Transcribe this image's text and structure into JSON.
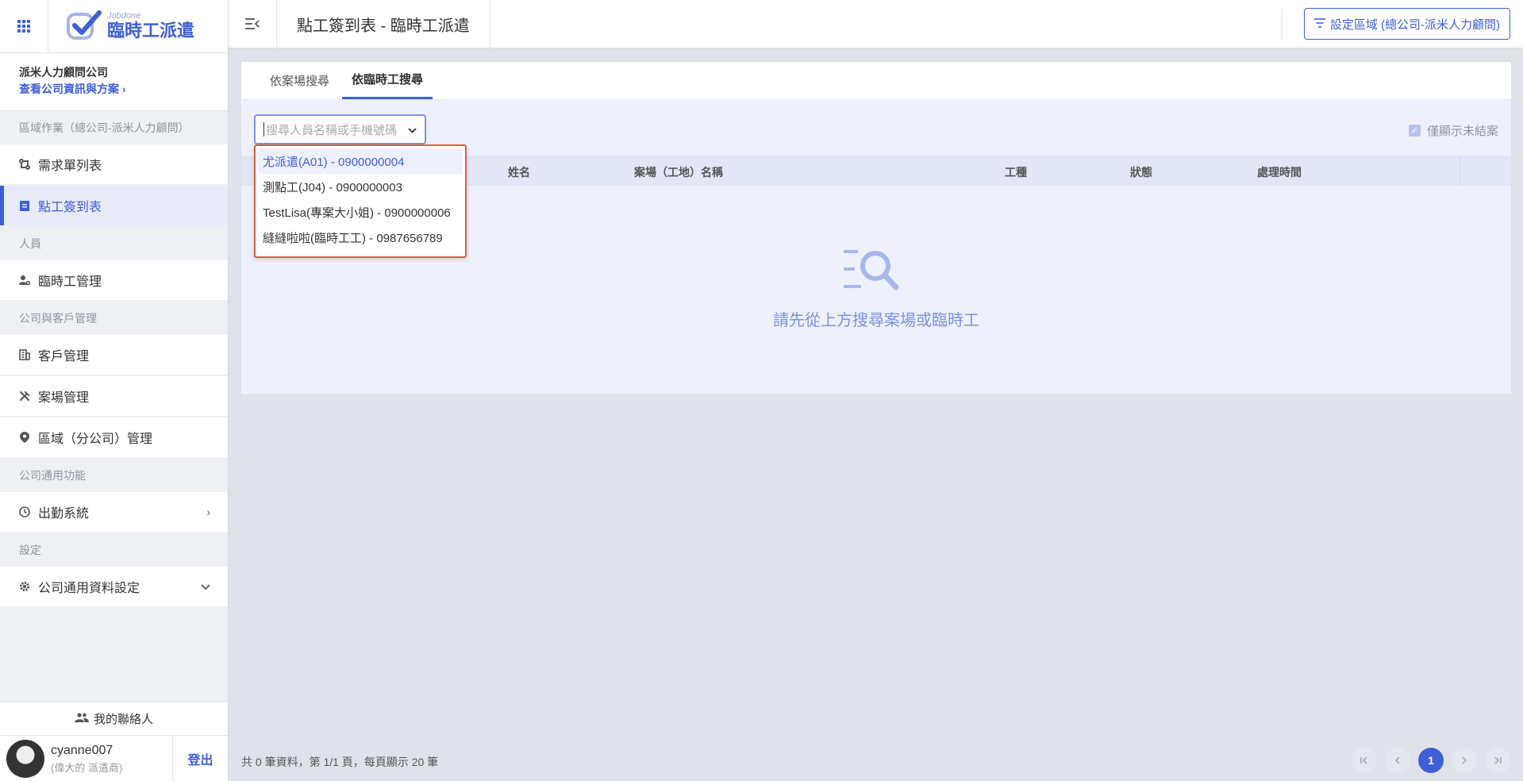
{
  "app": {
    "logo_small": "Jobdone",
    "logo_big": "臨時工派遣"
  },
  "sidebar": {
    "company_name": "派米人力顧問公司",
    "company_link": "查看公司資訊與方案",
    "sections": {
      "s1": "區域作業（總公司-派米人力顧問）",
      "s2": "人員",
      "s3": "公司與客戶管理",
      "s4": "公司通用功能",
      "s5": "設定"
    },
    "items": {
      "orders": "需求單列表",
      "attendance": "點工簽到表",
      "workers": "臨時工管理",
      "customers": "客戶管理",
      "sites": "案場管理",
      "regions": "區域（分公司）管理",
      "clock": "出勤系統",
      "common_settings": "公司通用資料設定"
    },
    "contacts": "我的聯絡人",
    "user": {
      "name": "cyanne007",
      "role": "(偉大的 派遣商)"
    },
    "logout": "登出"
  },
  "header": {
    "title": "點工簽到表 - 臨時工派遣",
    "region_button": "設定區域 (總公司-派米人力顧問)"
  },
  "tabs": {
    "by_site": "依案場搜尋",
    "by_worker": "依臨時工搜尋"
  },
  "search": {
    "placeholder": "搜尋人員名稱或手機號碼"
  },
  "only_open": "僅顯示未結案",
  "table": {
    "headers": [
      "姓名",
      "案場（工地）名稱",
      "工種",
      "狀態",
      "處理時間"
    ]
  },
  "empty_text": "請先從上方搜尋案場或臨時工",
  "dropdown": {
    "options": [
      "尤派遣(A01) - 0900000004",
      "測點工(J04) - 0900000003",
      "TestLisa(專案大小姐) - 0900000006",
      "縫縫啦啦(臨時工工) - 0987656789"
    ]
  },
  "footer": {
    "summary": "共 0 筆資料，第 1/1 頁，每頁顯示 20 筆"
  },
  "pager": {
    "current": "1"
  },
  "colors": {
    "accent": "#3e5fd8",
    "highlight_border": "#e05a4c"
  }
}
